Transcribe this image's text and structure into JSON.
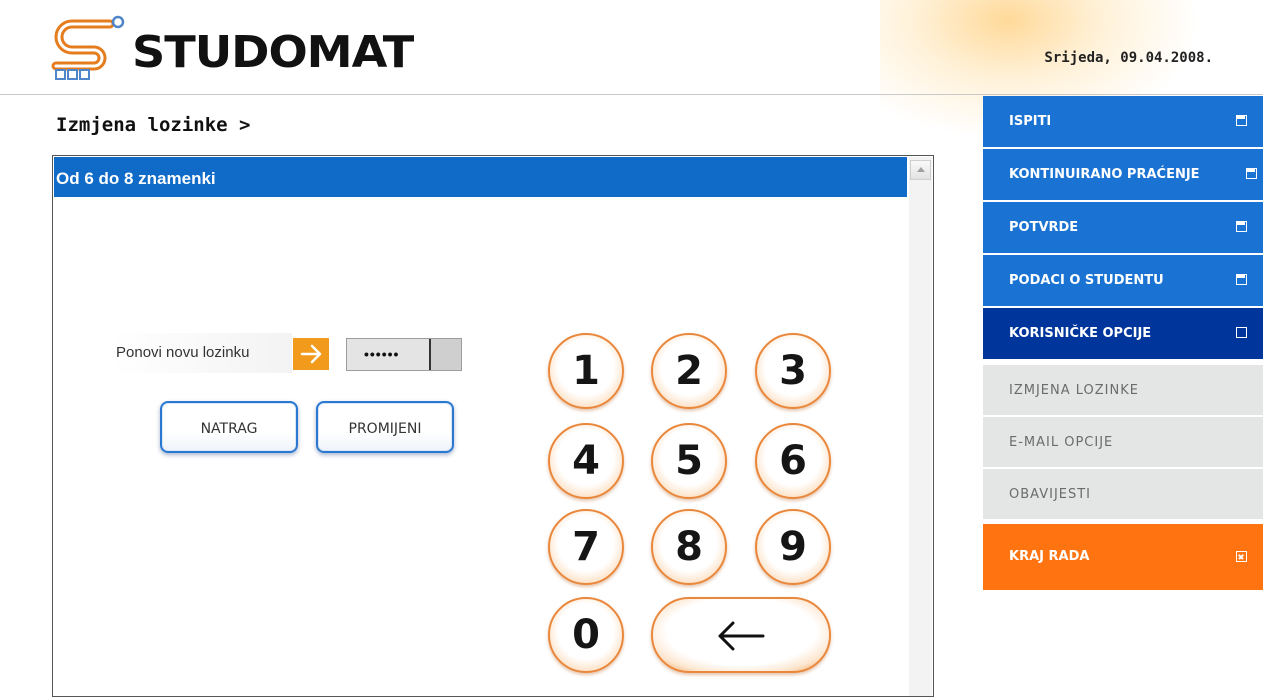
{
  "header": {
    "logo_text": "STUDOMAT",
    "date": "Srijeda, 09.04.2008."
  },
  "page": {
    "title": "Izmjena lozinke >"
  },
  "panel": {
    "heading": "Od 6 do 8 znamenki",
    "password_label": "Ponovi novu lozinku",
    "password_value": "••••••",
    "back_button": "NATRAG",
    "change_button": "PROMIJENI"
  },
  "keypad": {
    "keys": [
      "1",
      "2",
      "3",
      "4",
      "5",
      "6",
      "7",
      "8",
      "9",
      "0"
    ],
    "backspace_icon": "left-arrow-icon"
  },
  "sidebar": {
    "items": [
      {
        "label": "ISPITI",
        "icon": "expand-icon"
      },
      {
        "label": "KONTINUIRANO PRAĆENJE",
        "icon": "expand-icon"
      },
      {
        "label": "POTVRDE",
        "icon": "expand-icon"
      },
      {
        "label": "PODACI O STUDENTU",
        "icon": "expand-icon"
      },
      {
        "label": "KORISNIČKE OPCIJE",
        "icon": "collapse-icon"
      },
      {
        "label": "IZMJENA LOZINKE"
      },
      {
        "label": "E-MAIL OPCIJE"
      },
      {
        "label": "OBAVIJESTI"
      },
      {
        "label": "KRAJ RADA",
        "icon": "close-icon"
      }
    ]
  },
  "colors": {
    "nav_blue": "#1a73d3",
    "nav_active": "#00359b",
    "nav_sub": "#e4e6e6",
    "nav_exit": "#ff7410",
    "panel_bar": "#0f6bc7",
    "key_accent": "#e9883c"
  }
}
